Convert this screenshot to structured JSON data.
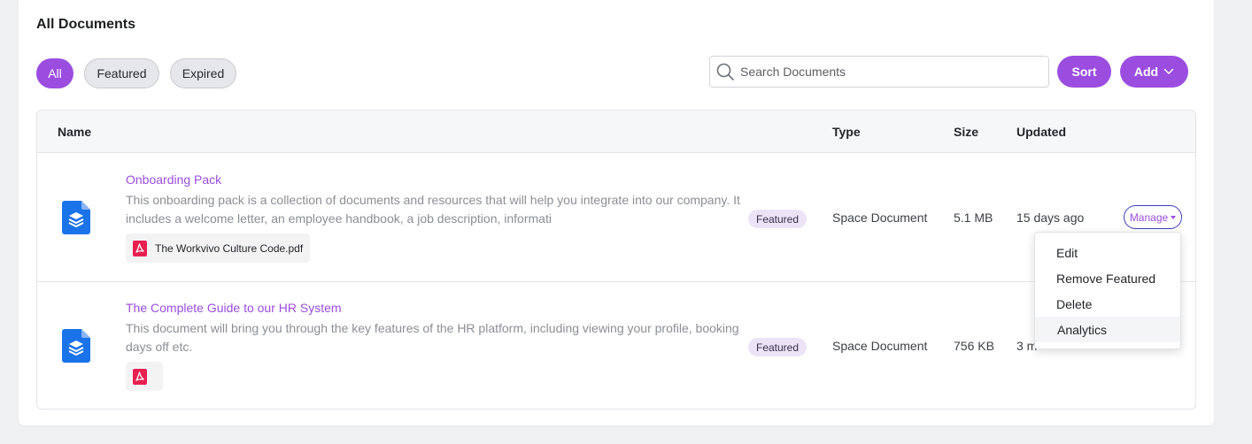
{
  "header": {
    "title": "All Documents"
  },
  "filters": [
    {
      "label": "All",
      "active": true
    },
    {
      "label": "Featured",
      "active": false
    },
    {
      "label": "Expired",
      "active": false
    }
  ],
  "search": {
    "placeholder": "Search Documents",
    "value": ""
  },
  "actions": {
    "sort_label": "Sort",
    "add_label": "Add"
  },
  "table": {
    "columns": {
      "name": "Name",
      "type": "Type",
      "size": "Size",
      "updated": "Updated"
    },
    "rows": [
      {
        "title": "Onboarding Pack",
        "description": "This onboarding pack is a collection of documents and resources that will help you integrate into our company. It includes a welcome letter, an employee handbook, a job description, informati",
        "attachment": "The Workvivo Culture Code.pdf",
        "badge": "Featured",
        "type": "Space Document",
        "size": "5.1 MB",
        "updated": "15 days ago",
        "manage_label": "Manage"
      },
      {
        "title": "The Complete Guide to our HR System",
        "description": "This document will bring you through the key features of the HR platform, including viewing your profile, booking days off etc.",
        "attachment": "",
        "badge": "Featured",
        "type": "Space Document",
        "size": "756 KB",
        "updated": "3 m"
      }
    ]
  },
  "manage_menu": {
    "items": [
      "Edit",
      "Remove Featured",
      "Delete",
      "Analytics"
    ],
    "hovered_index": 3
  },
  "colors": {
    "accent": "#9b4de0",
    "pdf_red": "#e8204f",
    "doc_blue": "#1a73e8"
  }
}
